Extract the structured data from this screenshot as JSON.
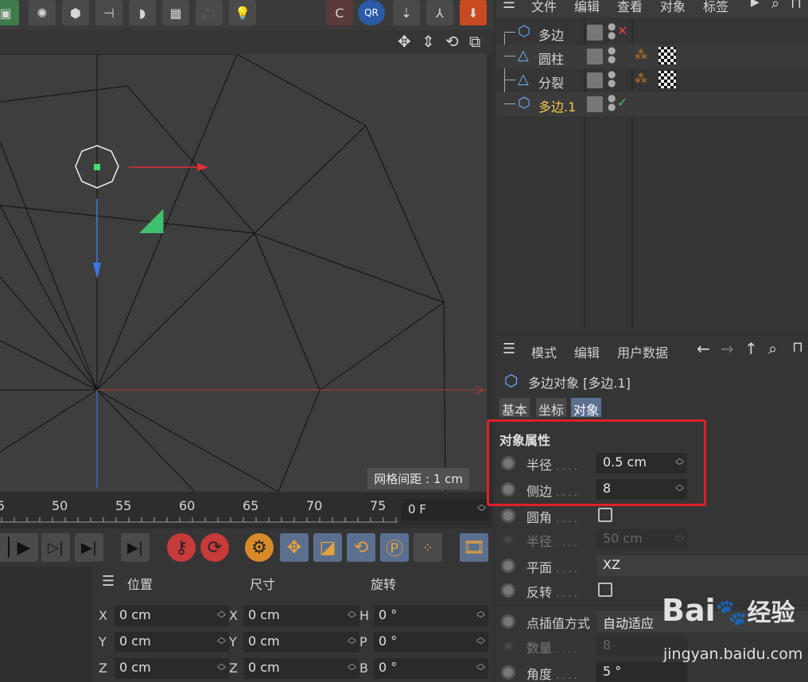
{
  "menu_om": {
    "file": "文件",
    "edit": "编辑",
    "view": "查看",
    "object": "对象",
    "tag": "标签"
  },
  "objects": [
    {
      "name": "多边",
      "status": "✕",
      "status_color": "#e04040",
      "highlight": false
    },
    {
      "name": "圆柱",
      "status": "",
      "highlight": false
    },
    {
      "name": "分裂",
      "status": "",
      "highlight": false
    },
    {
      "name": "多边.1",
      "status": "✓",
      "status_color": "#3fbf5f",
      "highlight": true
    }
  ],
  "attr_menu": {
    "mode": "模式",
    "edit": "编辑",
    "user_data": "用户数据"
  },
  "attr_title": "多边对象 [多边.1]",
  "tabs": [
    {
      "label": "基本"
    },
    {
      "label": "坐标"
    },
    {
      "label": "对象"
    }
  ],
  "section_title": "对象属性",
  "props": {
    "radius": {
      "label": "半径",
      "value": "0.5 cm"
    },
    "sides": {
      "label": "侧边",
      "value": "8"
    },
    "fillet": {
      "label": "圆角"
    },
    "fillet_radius": {
      "label": "半径",
      "value": "50 cm"
    },
    "plane": {
      "label": "平面",
      "value": "XZ"
    },
    "reverse": {
      "label": "反转"
    },
    "interp": {
      "label": "点插值方式",
      "value": "自动适应"
    },
    "count": {
      "label": "数量",
      "value": "8"
    },
    "angle": {
      "label": "角度",
      "value": "5 °"
    }
  },
  "dots": ". . . .",
  "grid_label": "网格间距 : 1 cm",
  "timeline_ticks": [
    "5",
    "50",
    "55",
    "60",
    "65",
    "70",
    "75"
  ],
  "frame_value": "0 F",
  "coord": {
    "headers": {
      "position": "位置",
      "size": "尺寸",
      "rotation": "旋转"
    },
    "rows": [
      {
        "a1": "X",
        "v1": "0 cm",
        "a2": "X",
        "v2": "0 cm",
        "a3": "H",
        "v3": "0 °"
      },
      {
        "a1": "Y",
        "v1": "0 cm",
        "a2": "Y",
        "v2": "0 cm",
        "a3": "P",
        "v3": "0 °"
      },
      {
        "a1": "Z",
        "v1": "0 cm",
        "a2": "Z",
        "v2": "0 cm",
        "a3": "B",
        "v3": "0 °"
      }
    ]
  },
  "watermark": {
    "brand_left": "Bai",
    "brand_right": "经验",
    "url": "jingyan.baidu.com"
  },
  "colors": {
    "accent_blue": "#5b6f8f",
    "highlight_red": "#e0202a",
    "yellow_text": "#f2c94c"
  }
}
